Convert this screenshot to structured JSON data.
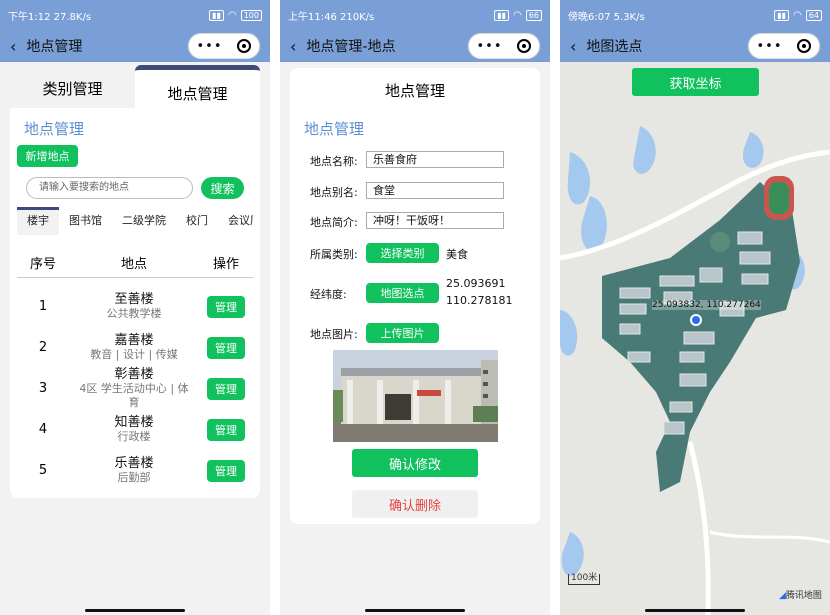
{
  "phone1": {
    "status": {
      "time": "下午1:12",
      "speed": "27.8K/s",
      "battery": "100"
    },
    "nav": {
      "title": "地点管理"
    },
    "tabs": [
      "类别管理",
      "地点管理"
    ],
    "section_title": "地点管理",
    "add_button": "新增地点",
    "search": {
      "placeholder": "请输入要搜索的地点",
      "button": "搜索"
    },
    "categories": [
      "楼宇",
      "图书馆",
      "二级学院",
      "校门",
      "会议厅"
    ],
    "table_headers": [
      "序号",
      "地点",
      "操作"
    ],
    "rows": [
      {
        "no": "1",
        "name": "至善楼",
        "sub": "公共教学楼",
        "action": "管理"
      },
      {
        "no": "2",
        "name": "嘉善楼",
        "sub": "教音 | 设计 | 传媒",
        "action": "管理"
      },
      {
        "no": "3",
        "name": "彰善楼",
        "sub": "4区 学生活动中心 | 体育",
        "action": "管理"
      },
      {
        "no": "4",
        "name": "知善楼",
        "sub": "行政楼",
        "action": "管理"
      },
      {
        "no": "5",
        "name": "乐善楼",
        "sub": "后勤部",
        "action": "管理"
      }
    ]
  },
  "phone2": {
    "status": {
      "time": "上午11:46",
      "speed": "210K/s",
      "battery": "66"
    },
    "nav": {
      "title": "地点管理-地点"
    },
    "card_title": "地点管理",
    "section_title": "地点管理",
    "labels": {
      "name": "地点名称:",
      "alias": "地点别名:",
      "intro": "地点简介:",
      "category": "所属类别:",
      "latlng": "经纬度:",
      "image": "地点图片:"
    },
    "values": {
      "name": "乐善食府",
      "alias": "食堂",
      "intro": "冲呀！干饭呀！",
      "category": "美食",
      "lat": "25.093691",
      "lng": "110.278181"
    },
    "buttons": {
      "select_category": "选择类别",
      "map_pick": "地图选点",
      "upload": "上传图片",
      "confirm": "确认修改",
      "delete": "确认删除"
    }
  },
  "phone3": {
    "status": {
      "time": "傍晚6:07",
      "speed": "5.3K/s",
      "battery": "64"
    },
    "nav": {
      "title": "地图选点"
    },
    "get_button": "获取坐标",
    "coord_label": "25.093832, 110.277264",
    "scale": "100米",
    "map_logo": "腾讯地图"
  },
  "colors": {
    "accent_green": "#10c15e",
    "nav_blue": "#7a9fd6",
    "title_blue": "#5b8fd0",
    "danger": "#e64340"
  }
}
